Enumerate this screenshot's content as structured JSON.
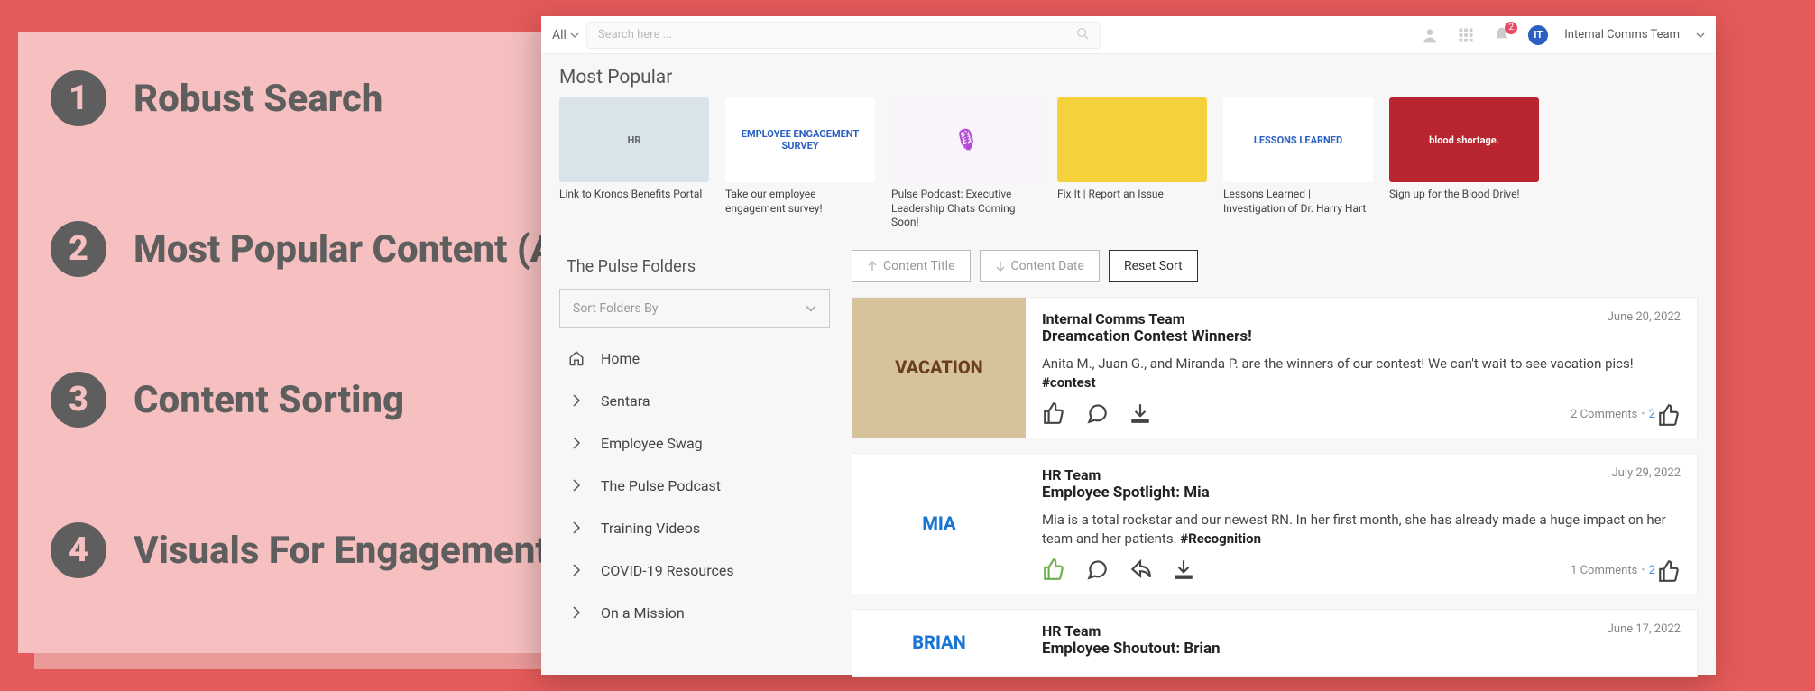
{
  "callout": {
    "items": [
      {
        "num": "1",
        "label": "Robust Search"
      },
      {
        "num": "2",
        "label": "Most Popular Content (AI)"
      },
      {
        "num": "3",
        "label": "Content Sorting"
      },
      {
        "num": "4",
        "label": "Visuals For Engagement"
      }
    ]
  },
  "header": {
    "scope": "All",
    "search_placeholder": "Search here ...",
    "notification_count": "2",
    "user_initials": "IT",
    "user_name": "Internal Comms Team"
  },
  "popular": {
    "title": "Most Popular",
    "cards": [
      {
        "thumb": "HR",
        "title": "Link to Kronos Benefits Portal"
      },
      {
        "thumb": "EMPLOYEE ENGAGEMENT SURVEY",
        "title": "Take our employee engagement survey!"
      },
      {
        "thumb": "🎙",
        "title": "Pulse Podcast: Executive Leadership Chats Coming Soon!"
      },
      {
        "thumb": "",
        "title": "Fix It | Report an Issue"
      },
      {
        "thumb": "LESSONS LEARNED",
        "title": "Lessons Learned | Investigation of Dr. Harry Hart"
      },
      {
        "thumb": "blood shortage.",
        "title": "Sign up for the Blood Drive!"
      }
    ]
  },
  "sidebar": {
    "title": "The Pulse Folders",
    "sort_placeholder": "Sort Folders By",
    "folders": [
      "Home",
      "Sentara",
      "Employee Swag",
      "The Pulse Podcast",
      "Training Videos",
      "COVID-19 Resources",
      "On a Mission"
    ]
  },
  "sort": {
    "title_btn": "Content Title",
    "date_btn": "Content Date",
    "reset_btn": "Reset Sort"
  },
  "feed": [
    {
      "author": "Internal Comms Team",
      "title": "Dreamcation Contest Winners!",
      "date": "June 20, 2022",
      "img": "VACATION",
      "text": "Anita M., Juan G., and Miranda P. are the winners of our contest! We can't wait to see vacation pics! ",
      "hashtag": "#contest",
      "comments": "2 Comments",
      "likes": "2",
      "liked": false
    },
    {
      "author": "HR Team",
      "title": "Employee Spotlight: Mia",
      "date": "July 29, 2022",
      "img": "MIA",
      "text": "Mia is a total rockstar and our newest RN. In her first month, she has already made a huge impact on her team and her patients. ",
      "hashtag": "#Recognition",
      "comments": "1 Comments",
      "likes": "2",
      "liked": true
    },
    {
      "author": "HR Team",
      "title": "Employee Shoutout: Brian",
      "date": "June 17, 2022",
      "img": "BRIAN",
      "text": "",
      "hashtag": "",
      "comments": "",
      "likes": "",
      "liked": false
    }
  ]
}
